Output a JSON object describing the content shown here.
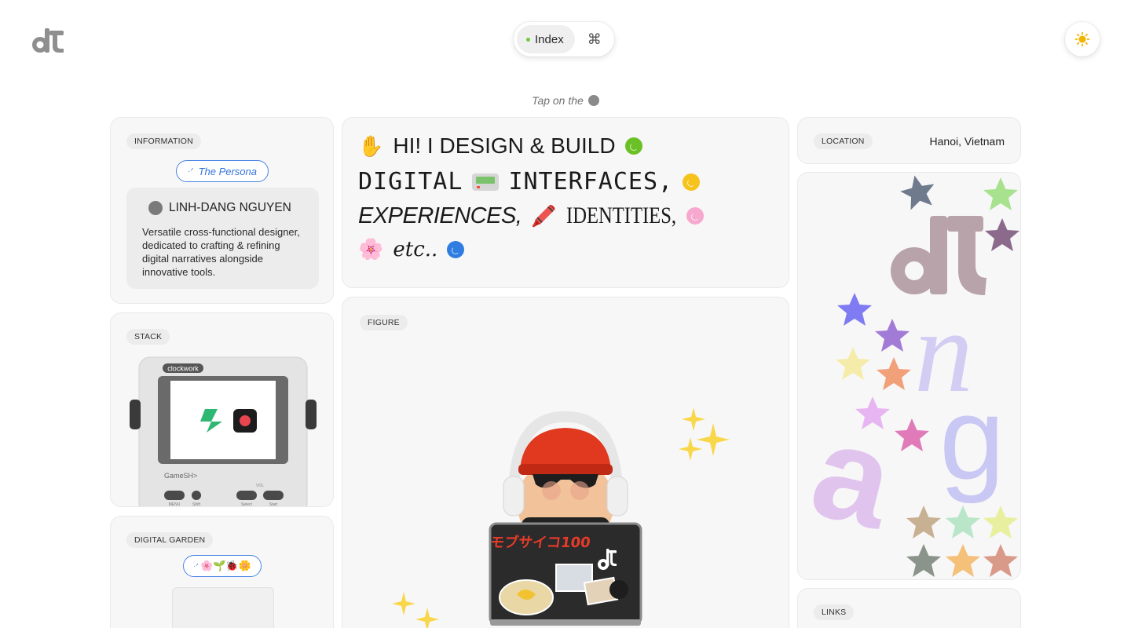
{
  "header": {
    "nav_index_label": "Index",
    "nav_command_symbol": "⌘",
    "theme_icon": "sun-icon"
  },
  "hint": {
    "text": "Tap on the"
  },
  "information": {
    "tag": "INFORMATION",
    "persona_pill": "The Persona",
    "name": "LINH-DANG NGUYEN",
    "description": "Versatile cross-functional designer, dedicated to crafting & refining digital narratives alongside innovative tools."
  },
  "stack": {
    "tag": "STACK",
    "device_brand": "clockwork",
    "device_model": "GameSH>",
    "buttons": [
      "MENU",
      "Shift",
      "Select",
      "Start"
    ],
    "vol_label": "VOL"
  },
  "garden": {
    "tag": "DIGITAL GARDEN",
    "emojis": "🌸🌱🐞🌼"
  },
  "hero": {
    "line1": "HI! I DESIGN & BUILD",
    "line2": "DIGITAL",
    "line2b": "INTERFACES,",
    "line3a": "EXPERIENCES,",
    "line3b": "IDENTITIES,",
    "line4": "etc..",
    "ball_colors": [
      "#6ac025",
      "#f6c21c",
      "#f6a8cf",
      "#2f7de0"
    ]
  },
  "figure": {
    "tag": "FIGURE",
    "sticker_text": "モブサイコ100"
  },
  "location": {
    "tag": "LOCATION",
    "value": "Hanoi, Vietnam"
  },
  "art": {
    "letters": [
      "d",
      "n",
      "a",
      "g"
    ]
  },
  "links": {
    "tag": "LINKS"
  },
  "colors": {
    "accent_blue": "#3373dc",
    "status_green": "#6fca3c",
    "card_bg": "#f7f7f7"
  }
}
